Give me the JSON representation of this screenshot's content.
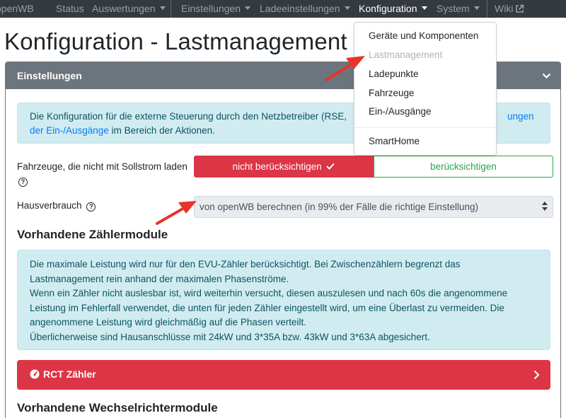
{
  "navbar": {
    "brand": "openWB",
    "items": [
      {
        "label": "Status"
      },
      {
        "label": "Auswertungen"
      },
      {
        "label": "Einstellungen"
      },
      {
        "label": "Ladeeinstellungen"
      },
      {
        "label": "Konfiguration"
      },
      {
        "label": "System"
      },
      {
        "label": "Wiki"
      }
    ]
  },
  "page": {
    "title": "Konfiguration - Lastmanagement"
  },
  "card": {
    "header": "Einstellungen",
    "alert_text": "Die Konfiguration für die externe Steuerung durch den Netzbetreiber (RSE,",
    "alert_link_end": "ungen",
    "alert_link_line2": "der Ein-/Ausgänge",
    "alert_text_end": " im Bereich der Aktionen.",
    "vehicles_label": "Fahrzeuge, die nicht mit Sollstrom laden",
    "vehicles_option_active": "nicht berücksichtigen",
    "vehicles_option_other": "berücksichtigen",
    "consumption_label": "Hausverbrauch",
    "consumption_value": "von openWB berechnen (in 99% der Fälle die richtige Einstellung)",
    "meters_heading": "Vorhandene Zählermodule",
    "meters_info": [
      "Die maximale Leistung wird nur für den EVU-Zähler berücksichtigt. Bei Zwischenzählern begrenzt das",
      "Lastmanagement rein anhand der maximalen Phasenströme.",
      "Wenn ein Zähler nicht auslesbar ist, wird weiterhin versucht, diesen auszulesen und nach 60s die angenommene",
      "Leistung im Fehlerfall verwendet, die unten für jeden Zähler eingestellt wird, um eine Überlast zu vermeiden. Die",
      "angenommene Leistung wird gleichmäßig auf die Phasen verteilt.",
      "Überlicherweise sind Hausanschlüsse mit 24kW und 3*35A bzw. 43kW und 3*63A abgesichert."
    ],
    "meter_item": "RCT Zähler",
    "inverters_heading": "Vorhandene Wechselrichtermodule"
  },
  "dropdown": {
    "items": [
      {
        "label": "Geräte und Komponenten"
      },
      {
        "label": "Lastmanagement"
      },
      {
        "label": "Ladepunkte"
      },
      {
        "label": "Fahrzeuge"
      },
      {
        "label": "Ein-/Ausgänge"
      },
      {
        "label": "SmartHome"
      }
    ]
  },
  "colors": {
    "navbar_bg": "#343a40",
    "danger": "#dc3545",
    "success": "#28a745",
    "info_bg": "#d1ecf1",
    "annotation_arrow": "#e8322a"
  },
  "icons": [
    "caret-down-icon",
    "external-link-icon",
    "chevron-down-icon",
    "question-circle-icon",
    "check-icon",
    "tachometer-icon",
    "chevron-right-icon",
    "annotation-arrow"
  ]
}
